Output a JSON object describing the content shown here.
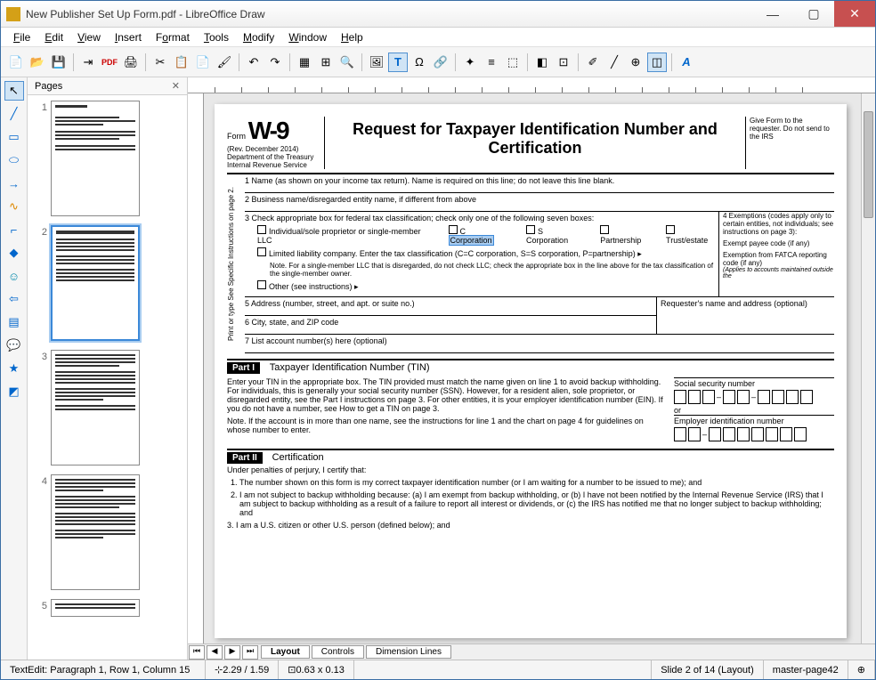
{
  "window": {
    "title": "New Publisher Set Up Form.pdf - LibreOffice Draw"
  },
  "menu": {
    "file": "File",
    "edit": "Edit",
    "view": "View",
    "insert": "Insert",
    "format": "Format",
    "tools": "Tools",
    "modify": "Modify",
    "window": "Window",
    "help": "Help"
  },
  "pages_panel": {
    "title": "Pages",
    "page_count": 5
  },
  "tabs": {
    "layout": "Layout",
    "controls": "Controls",
    "dimension": "Dimension Lines"
  },
  "statusbar": {
    "edit_mode": "TextEdit: Paragraph 1, Row 1, Column 15",
    "pos": "2.29 / 1.59",
    "size": "0.63 x 0.13",
    "slide": "Slide 2 of 14 (Layout)",
    "master": "master-page42"
  },
  "doc": {
    "form_label": "Form",
    "form_num": "W-9",
    "rev": "(Rev. December 2014)",
    "dept": "Department of the Treasury",
    "irs": "Internal Revenue Service",
    "title": "Request for Taxpayer Identification Number and Certification",
    "give_to": "Give Form to the requester. Do not send to the IRS",
    "sidebar_text": "Print or type\nSee Specific Instructions on page 2.",
    "line1": "1  Name (as shown on your income tax return). Name is required on this line; do not leave this line blank.",
    "line2": "2  Business name/disregarded entity name, if different from above",
    "line3": "3  Check appropriate box for federal tax classification; check only one of the following seven boxes:",
    "cb_individual": "Individual/sole proprietor or single-member LLC",
    "cb_ccorp": "C Corporation",
    "cb_scorp": "S Corporation",
    "cb_partnership": "Partnership",
    "cb_trust": "Trust/estate",
    "cb_llc": "Limited liability company. Enter the tax classification (C=C corporation, S=S corporation, P=partnership) ▸",
    "llc_note": "Note. For a single-member LLC that is disregarded, do not check LLC; check the appropriate box in the line above for the tax classification of the single-member owner.",
    "cb_other": "Other (see instructions) ▸",
    "exemptions_title": "4  Exemptions (codes apply only to certain entities, not individuals; see instructions on page 3):",
    "exempt_payee": "Exempt payee code (if any)",
    "exempt_fatca": "Exemption from FATCA reporting code (if any)",
    "fatca_note": "(Applies to accounts maintained outside the",
    "line5": "5  Address (number, street, and apt. or suite no.)",
    "requester": "Requester's name and address (optional)",
    "line6": "6  City, state, and ZIP code",
    "line7": "7  List account number(s) here (optional)",
    "part1": "Part I",
    "part1_title": "Taxpayer Identification Number (TIN)",
    "tin_text1": "Enter your TIN in the appropriate box. The TIN provided must match the name given on line 1 to avoid backup withholding. For individuals, this is generally your social security number (SSN). However, for a resident alien, sole proprietor, or disregarded entity, see the Part I instructions on page 3. For other entities, it is your employer identification number (EIN). If you do not have a number, see How to get a TIN on page 3.",
    "tin_text2": "Note. If the account is in more than one name, see the instructions for line 1 and the chart on page 4 for guidelines on whose number to enter.",
    "ssn_label": "Social security number",
    "or": "or",
    "ein_label": "Employer identification number",
    "part2": "Part II",
    "part2_title": "Certification",
    "cert_intro": "Under penalties of perjury, I certify that:",
    "cert1": "The number shown on this form is my correct taxpayer identification number (or I am waiting for a number to be issued to me); and",
    "cert2": "I am not subject to backup withholding because: (a) I am exempt from backup withholding, or (b) I have not been notified by the Internal Revenue Service (IRS) that I am subject to backup withholding as a result of a failure to report all interest or dividends, or (c) the IRS has notified me that no longer subject to backup withholding; and",
    "cert3": "I am a U.S. citizen or other U.S. person (defined below); and"
  }
}
